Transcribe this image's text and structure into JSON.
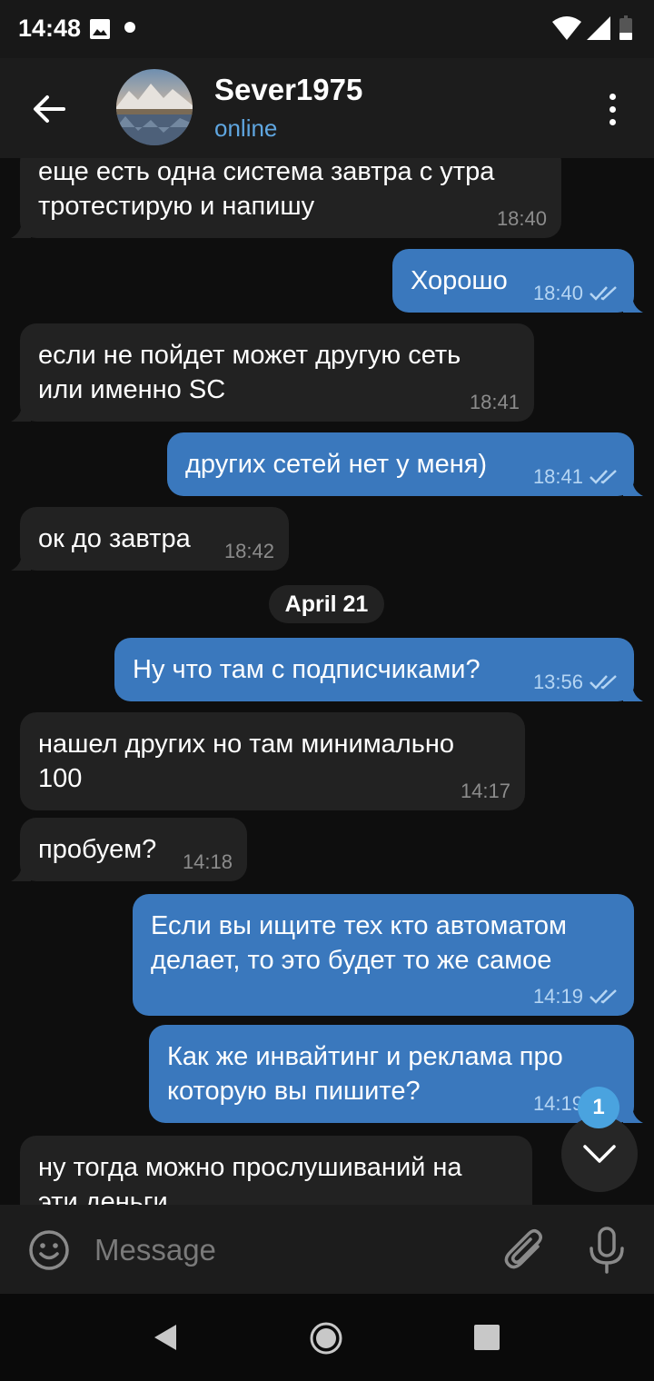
{
  "status_bar": {
    "time": "14:48"
  },
  "header": {
    "name": "Sever1975",
    "status": "online"
  },
  "messages": [
    {
      "dir": "in",
      "text": "еще есть одна система завтра с утра\nтротестирую и напишу",
      "time": "18:40"
    },
    {
      "dir": "out",
      "text": "Хорошо",
      "time": "18:40"
    },
    {
      "dir": "in",
      "text": "если не пойдет может другую сеть\nили именно SC",
      "time": "18:41"
    },
    {
      "dir": "out",
      "text": "других сетей нет у меня)",
      "time": "18:41"
    },
    {
      "dir": "in",
      "text": "ок до завтра",
      "time": "18:42"
    },
    {
      "dir": "out",
      "text": "Ну что там с подписчиками?",
      "time": "13:56"
    },
    {
      "dir": "in",
      "text": "нашел других но там минимально\n100",
      "time": "14:17"
    },
    {
      "dir": "in",
      "text": "пробуем?",
      "time": "14:18"
    },
    {
      "dir": "out",
      "text": "Если вы ищите тех кто автоматом\nделает, то это будет то же самое",
      "time": "14:19"
    },
    {
      "dir": "out",
      "text": "Как же инвайтинг и реклама про\nкоторую вы пишите?",
      "time": "14:19"
    },
    {
      "dir": "in",
      "text": "ну тогда можно прослушиваний на\nэти деньги",
      "time": ""
    }
  ],
  "date_separator": "April 21",
  "unread_count": "1",
  "composer": {
    "placeholder": "Message"
  },
  "colors": {
    "outgoing_bubble": "#3a78bd",
    "incoming_bubble": "#222222",
    "accent": "#4aa3df"
  }
}
